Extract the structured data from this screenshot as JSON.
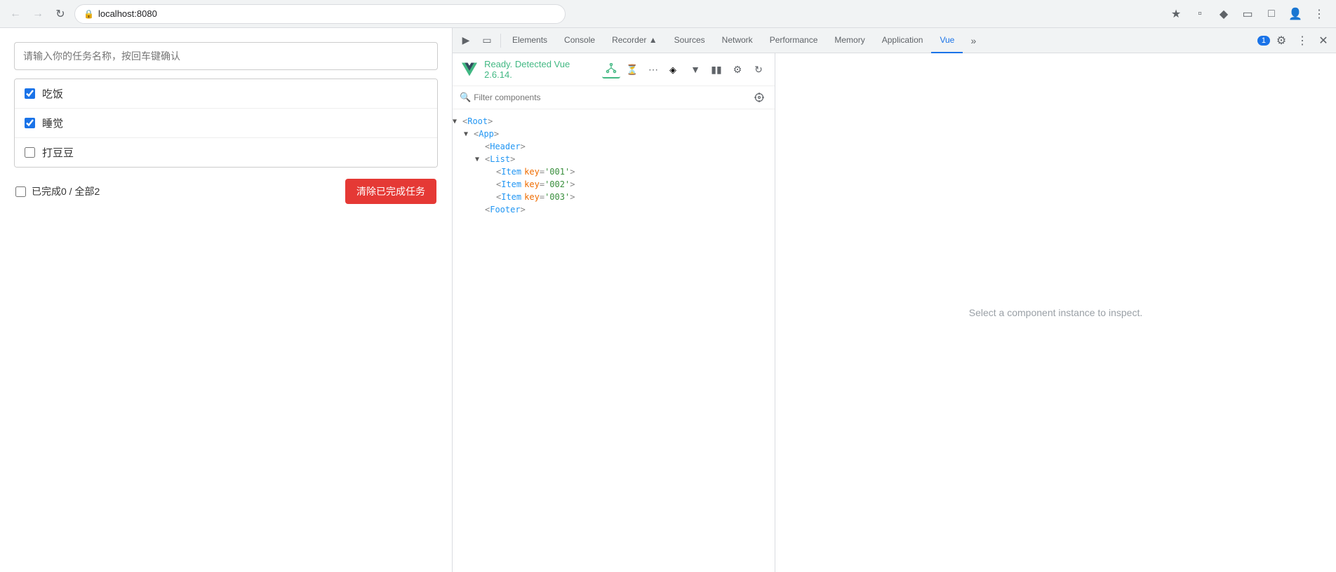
{
  "browser": {
    "url": "localhost:8080",
    "back_disabled": true,
    "forward_disabled": true
  },
  "app": {
    "input_placeholder": "请输入你的任务名称，按回车键确认",
    "tasks": [
      {
        "id": 1,
        "label": "吃饭",
        "checked": true
      },
      {
        "id": 2,
        "label": "睡觉",
        "checked": true
      },
      {
        "id": 3,
        "label": "打豆豆",
        "checked": false
      }
    ],
    "footer": {
      "all_checked": false,
      "status_text": "已完成0 / 全部2",
      "clear_btn_label": "清除已完成任务"
    }
  },
  "devtools": {
    "tabs": [
      {
        "id": "elements",
        "label": "Elements",
        "active": false
      },
      {
        "id": "console",
        "label": "Console",
        "active": false
      },
      {
        "id": "recorder",
        "label": "Recorder ▲",
        "active": false
      },
      {
        "id": "sources",
        "label": "Sources",
        "active": false
      },
      {
        "id": "network",
        "label": "Network",
        "active": false
      },
      {
        "id": "performance",
        "label": "Performance",
        "active": false
      },
      {
        "id": "memory",
        "label": "Memory",
        "active": false
      },
      {
        "id": "application",
        "label": "Application",
        "active": false
      },
      {
        "id": "vue",
        "label": "Vue",
        "active": true
      }
    ],
    "badge_count": "1"
  },
  "vue_devtools": {
    "ready_text": "Ready. Detected Vue 2.6.14.",
    "filter_placeholder": "Filter components",
    "inspector_placeholder": "Select a component instance to inspect.",
    "tree": [
      {
        "level": 0,
        "arrow": "▼",
        "tag": "Root",
        "attrs": []
      },
      {
        "level": 1,
        "arrow": "▼",
        "tag": "App",
        "attrs": []
      },
      {
        "level": 2,
        "arrow": " ",
        "tag": "Header",
        "attrs": []
      },
      {
        "level": 2,
        "arrow": "▼",
        "tag": "List",
        "attrs": []
      },
      {
        "level": 3,
        "arrow": " ",
        "tag": "Item",
        "attrs": [
          {
            "name": "key",
            "val": "'001'"
          }
        ]
      },
      {
        "level": 3,
        "arrow": " ",
        "tag": "Item",
        "attrs": [
          {
            "name": "key",
            "val": "'002'"
          }
        ]
      },
      {
        "level": 3,
        "arrow": " ",
        "tag": "Item",
        "attrs": [
          {
            "name": "key",
            "val": "'003'"
          }
        ]
      },
      {
        "level": 2,
        "arrow": " ",
        "tag": "Footer",
        "attrs": []
      }
    ]
  }
}
